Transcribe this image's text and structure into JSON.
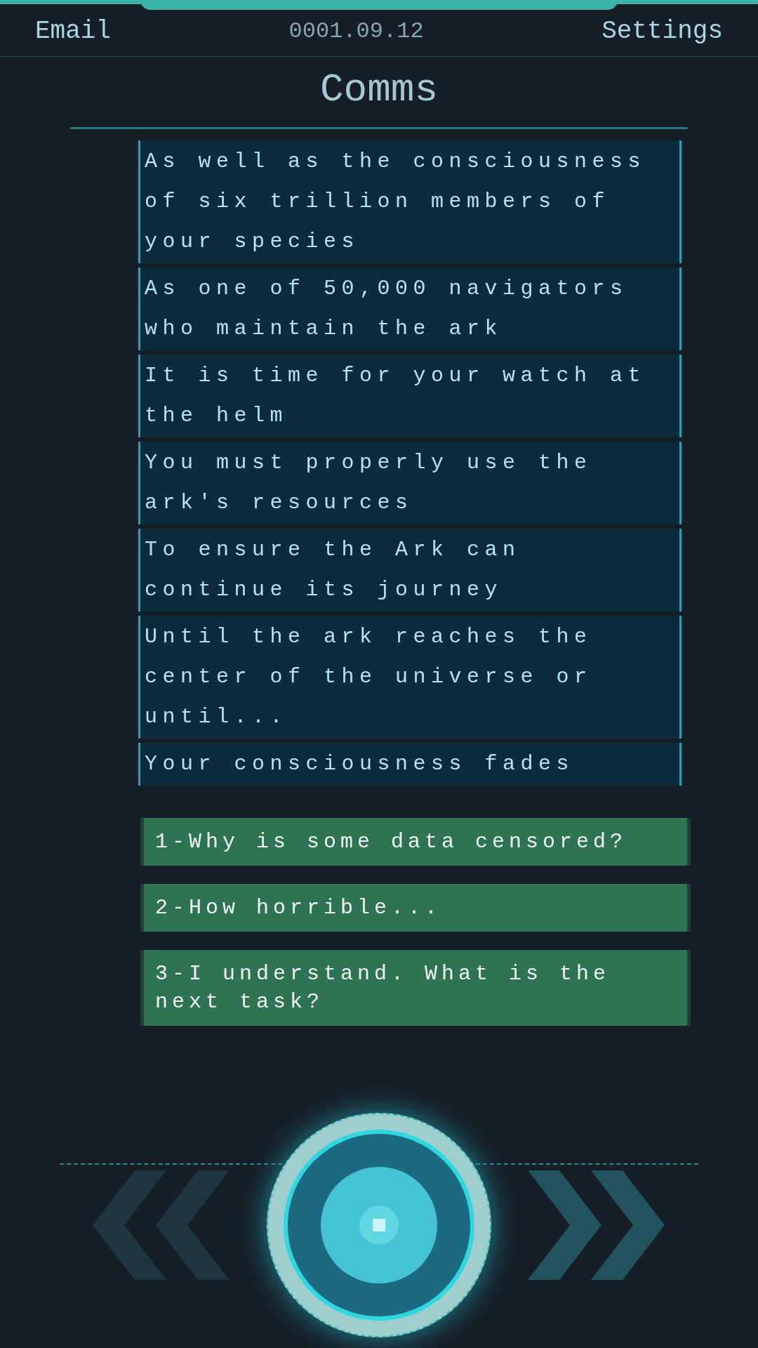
{
  "header": {
    "left": "Email",
    "date": "0001.09.12",
    "right": "Settings"
  },
  "title": "Comms",
  "messages": [
    "As well as the consciousness of six trillion members of your species",
    "As one of 50,000 navigators who maintain the ark",
    "It is time for your watch at the helm",
    "You must properly use the ark's resources",
    "To ensure the Ark can continue its journey",
    "Until the ark reaches the center of the universe or until...",
    "Your consciousness fades"
  ],
  "options": [
    "1-Why is some data censored?",
    "2-How horrible...",
    "3-I understand. What is the next task?"
  ]
}
